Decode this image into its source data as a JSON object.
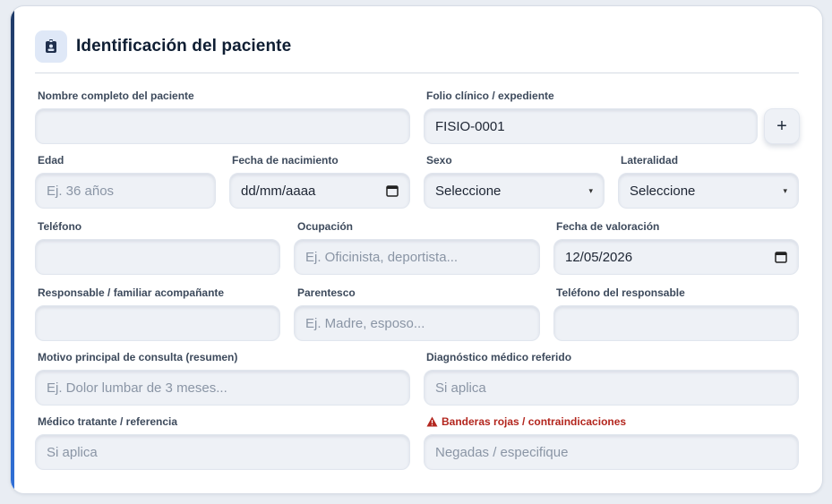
{
  "section": {
    "title": "Identificación del paciente",
    "icon": "id-badge-icon"
  },
  "fields": {
    "nombre": {
      "label": "Nombre completo del paciente",
      "value": ""
    },
    "folio": {
      "label": "Folio clínico / expediente",
      "value": "FISIO-0001"
    },
    "add_button": "+",
    "edad": {
      "label": "Edad",
      "placeholder": "Ej. 36 años"
    },
    "nacimiento": {
      "label": "Fecha de nacimiento",
      "value": "dd/mm/aaaa"
    },
    "sexo": {
      "label": "Sexo",
      "value": "Seleccione"
    },
    "lateralidad": {
      "label": "Lateralidad",
      "value": "Seleccione"
    },
    "telefono": {
      "label": "Teléfono",
      "value": ""
    },
    "ocupacion": {
      "label": "Ocupación",
      "placeholder": "Ej. Oficinista, deportista..."
    },
    "valoracion": {
      "label": "Fecha de valoración",
      "value": "12/05/2026"
    },
    "responsable": {
      "label": "Responsable / familiar acompañante",
      "value": ""
    },
    "parentesco": {
      "label": "Parentesco",
      "placeholder": "Ej. Madre, esposo..."
    },
    "tel_responsable": {
      "label": "Teléfono del responsable",
      "value": ""
    },
    "motivo": {
      "label": "Motivo principal de consulta (resumen)",
      "placeholder": "Ej. Dolor lumbar de 3 meses..."
    },
    "diagnostico": {
      "label": "Diagnóstico médico referido",
      "placeholder": "Si aplica"
    },
    "medico": {
      "label": "Médico tratante / referencia",
      "placeholder": "Si aplica"
    },
    "banderas": {
      "label": "Banderas rojas / contraindicaciones",
      "placeholder": "Negadas / especifique"
    }
  },
  "colors": {
    "accent": "#2f6fd8",
    "warning": "#b3261e",
    "title": "#0f1e33"
  }
}
